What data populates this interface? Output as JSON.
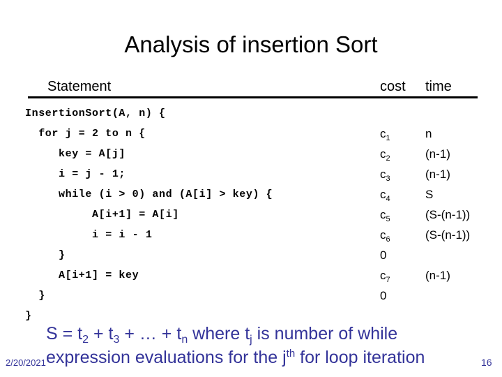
{
  "slide": {
    "title": "Analysis of insertion Sort",
    "table": {
      "headers": {
        "statement": "Statement",
        "cost": "cost",
        "time": "time"
      },
      "rows": [
        {
          "code": "InsertionSort(A, n) {",
          "cost": "",
          "cost_sub": "",
          "time": ""
        },
        {
          "code": "  for j = 2 to n {",
          "cost": "c",
          "cost_sub": "1",
          "time": "n"
        },
        {
          "code": "     key = A[j]",
          "cost": "c",
          "cost_sub": "2",
          "time": "(n-1)"
        },
        {
          "code": "     i = j - 1;",
          "cost": "c",
          "cost_sub": "3",
          "time": "(n-1)"
        },
        {
          "code": "     while (i > 0) and (A[i] > key) {",
          "cost": "c",
          "cost_sub": "4",
          "time": "S"
        },
        {
          "code": "          A[i+1] = A[i]",
          "cost": "c",
          "cost_sub": "5",
          "time": "(S-(n-1))"
        },
        {
          "code": "          i = i - 1",
          "cost": "c",
          "cost_sub": "6",
          "time": "(S-(n-1))"
        },
        {
          "code": "     }",
          "cost": "0",
          "cost_sub": "",
          "time": ""
        },
        {
          "code": "     A[i+1] = key",
          "cost": "c",
          "cost_sub": "7",
          "time": "(n-1)"
        },
        {
          "code": "  }",
          "cost": "0",
          "cost_sub": "",
          "time": ""
        },
        {
          "code": "}",
          "cost": "",
          "cost_sub": "",
          "time": ""
        }
      ]
    },
    "note": {
      "line1_a": "S = t",
      "line1_sub1": "2",
      "line1_b": " + t",
      "line1_sub2": "3",
      "line1_c": " + … + t",
      "line1_sub3": "n",
      "line1_d": " where t",
      "line1_sub4": "j",
      "line1_e": " is number of while",
      "line2_a": "expression evaluations for the  j",
      "line2_sup": "th",
      "line2_b": " for loop iteration"
    },
    "footer": {
      "date": "2/20/2021",
      "page": "16"
    },
    "colors": {
      "text": "#000000",
      "note": "#333399",
      "background": "#ffffff"
    }
  }
}
